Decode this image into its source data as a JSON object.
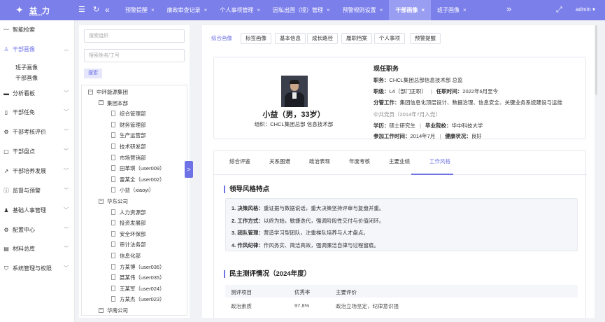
{
  "app": {
    "brand": "益 力",
    "brand_sub": "Extalent",
    "user": "admin ▾"
  },
  "icons": {
    "menu": "hamburger-icon",
    "refresh": "refresh-icon",
    "collapse": "double-chevron-left-icon",
    "more": "double-chevron-right-icon",
    "fullscreen": "fullscreen-icon"
  },
  "tabs": [
    {
      "label": "预警提醒",
      "closable": true
    },
    {
      "label": "廉政审查记录",
      "closable": true
    },
    {
      "label": "个人事项管理",
      "closable": true
    },
    {
      "label": "因私出国（境）管理",
      "closable": true
    },
    {
      "label": "预警规则设置",
      "closable": true
    },
    {
      "label": "干部画像",
      "closable": true,
      "active": true
    },
    {
      "label": "班子画像",
      "closable": true
    }
  ],
  "sidebar": {
    "items": [
      {
        "label": "智能检索",
        "icon": "activity-icon"
      },
      {
        "label": "干部画像",
        "icon": "user-icon",
        "expanded": true
      },
      {
        "label": "分析看板",
        "icon": "dashboard-icon"
      },
      {
        "label": "干部任免",
        "icon": "columns-icon"
      },
      {
        "label": "干部考核评价",
        "icon": "gear-icon"
      },
      {
        "label": "干部盘点",
        "icon": "clipboard-icon"
      },
      {
        "label": "干部培养发展",
        "icon": "growth-icon"
      },
      {
        "label": "监督与预警",
        "icon": "alert-icon"
      },
      {
        "label": "基础人事管理",
        "icon": "person-icon"
      },
      {
        "label": "配置中心",
        "icon": "config-icon"
      },
      {
        "label": "材料总库",
        "icon": "library-icon"
      },
      {
        "label": "系统管理与权限",
        "icon": "shield-icon"
      }
    ],
    "subitems": [
      "班子画像",
      "干部画像"
    ]
  },
  "tree_search": {
    "org_placeholder": "搜索组织",
    "name_placeholder": "搜索姓名/工号",
    "button": "搜索"
  },
  "tree": [
    {
      "label": "中环能源集团",
      "level": 0,
      "folder": true
    },
    {
      "label": "集团本部",
      "level": 1,
      "folder": true
    },
    {
      "label": "综合管理部",
      "level": 2
    },
    {
      "label": "财务管理部",
      "level": 2
    },
    {
      "label": "生产运营部",
      "level": 2
    },
    {
      "label": "技术研发部",
      "level": 2
    },
    {
      "label": "市场营销部",
      "level": 2
    },
    {
      "label": "田革琪（user009）",
      "level": 2
    },
    {
      "label": "雷某全（user002）",
      "level": 2
    },
    {
      "label": "小益（xiaoyi）",
      "level": 2
    },
    {
      "label": "华东公司",
      "level": 1,
      "folder": true
    },
    {
      "label": "人力资源部",
      "level": 2
    },
    {
      "label": "投资发展部",
      "level": 2
    },
    {
      "label": "安全环保部",
      "level": 2
    },
    {
      "label": "审计法务部",
      "level": 2
    },
    {
      "label": "信息化部",
      "level": 2
    },
    {
      "label": "方某博（user036）",
      "level": 2
    },
    {
      "label": "聂某伟（user035）",
      "level": 2
    },
    {
      "label": "王某军（user024）",
      "level": 2
    },
    {
      "label": "方某杰（user023）",
      "level": 2
    },
    {
      "label": "华南公司",
      "level": 1,
      "folder": true
    }
  ],
  "profile_tabs": [
    "综合画像",
    "标签画像",
    "基本信息",
    "成长路径",
    "履职档案",
    "个人事项",
    "预警提醒"
  ],
  "profile": {
    "name": "小益（男，33岁）",
    "org": "组织：CHCL集团总部 信息技术部",
    "current_title": "现任职务",
    "duty": {
      "k": "职务：",
      "v": "CHCL集团总部信息技术部 总监"
    },
    "rank": {
      "k": "职级：",
      "v": "L4（部门正职）"
    },
    "tenure": {
      "k": "任职时间：",
      "v": "2022年6月至今"
    },
    "work": {
      "k": "分管工作：",
      "v": "集团信息化顶层设计、数据治理、信息安全、关键业务系统建设与运维"
    },
    "party": "中共党员（2014年7月入党）",
    "edu": {
      "k": "学历：",
      "v": "硕士研究生"
    },
    "school": {
      "k": "毕业院校：",
      "v": "华中科技大学"
    },
    "join": {
      "k": "参加工作时间：",
      "v": "2014年7月"
    },
    "health": {
      "k": "健康状况：",
      "v": "良好"
    }
  },
  "sub_tabs": [
    "综合评鉴",
    "关系图谱",
    "政治表现",
    "年度考核",
    "主要业绩",
    "工作风格"
  ],
  "style_section": {
    "title": "领导风格特点",
    "traits": [
      {
        "k": "1. 决策风格：",
        "v": "重证据与数据说话，重大决策坚持评审与复盘并重。"
      },
      {
        "k": "2. 工作方式：",
        "v": "以终为始，敏捷迭代，强调阶段性交付与价值闭环。"
      },
      {
        "k": "3. 团队管理：",
        "v": "营造学习型团队，注重梯队培养与人才盘点。"
      },
      {
        "k": "4. 作风纪律：",
        "v": "作风务实、简洁高效，强调廉洁自律与过程留痕。"
      }
    ]
  },
  "eval_section": {
    "title": "民主测评情况（2024年度）",
    "headers": [
      "测评项目",
      "优秀率",
      "主要评价"
    ],
    "rows": [
      [
        "政治素质",
        "97.8%",
        "政治立场坚定，纪律意识强"
      ]
    ]
  }
}
